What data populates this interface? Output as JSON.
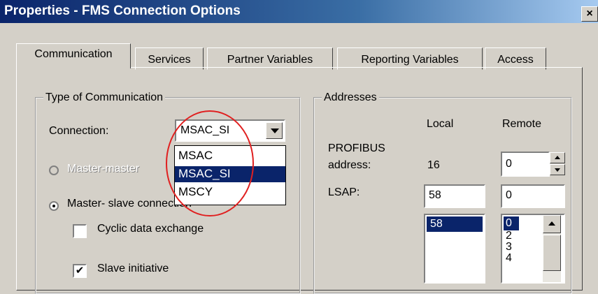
{
  "window": {
    "title": "Properties - FMS Connection Options",
    "close_label": "×"
  },
  "tabs": [
    {
      "label": "Communication",
      "active": true
    },
    {
      "label": "Services"
    },
    {
      "label": "Partner Variables"
    },
    {
      "label": "Reporting Variables"
    },
    {
      "label": "Access"
    }
  ],
  "type_of_communication": {
    "legend": "Type of Communication",
    "connection_label": "Connection:",
    "connection_value": "MSAC_SI",
    "options": [
      "MSAC",
      "MSAC_SI",
      "MSCY"
    ],
    "selected_option": "MSAC_SI",
    "radio_master_master": "Master-master",
    "radio_master_slave": "Master- slave connection",
    "cyclic_label": "Cyclic data exchange",
    "cyclic_checked": false,
    "slave_initiative_label": "Slave initiative",
    "slave_initiative_checked": true
  },
  "addresses": {
    "legend": "Addresses",
    "local_header": "Local",
    "remote_header": "Remote",
    "profibus_label_1": "PROFIBUS",
    "profibus_label_2": "address:",
    "profibus_local": "16",
    "profibus_remote": "0",
    "lsap_label": "LSAP:",
    "lsap_local": "58",
    "lsap_remote": "0",
    "local_list": [
      "58"
    ],
    "remote_list": [
      "0",
      "2",
      "3",
      "4"
    ]
  },
  "colors": {
    "selection": "#0a246a",
    "annotation": "#e02020",
    "face": "#d4d0c8"
  }
}
